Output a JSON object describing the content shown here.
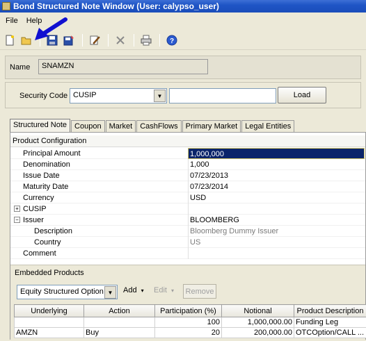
{
  "window": {
    "title": "Bond Structured Note Window (User: calypso_user)"
  },
  "menu": [
    {
      "label": "File"
    },
    {
      "label": "Help"
    }
  ],
  "toolbar": {
    "icons": [
      "new-icon",
      "open-icon",
      "save-icon",
      "save-as-icon",
      "edit-icon",
      "delete-icon",
      "print-icon",
      "help-icon"
    ],
    "annotation_arrow_color": "#1010d0"
  },
  "name_field": {
    "label": "Name",
    "value": "SNAMZN"
  },
  "security": {
    "label": "Security Code",
    "code_type": "CUSIP",
    "code_value": "",
    "load_label": "Load"
  },
  "tabs": [
    {
      "label": "Structured Note",
      "active": true
    },
    {
      "label": "Coupon"
    },
    {
      "label": "Market"
    },
    {
      "label": "CashFlows"
    },
    {
      "label": "Primary Market"
    },
    {
      "label": "Legal Entities"
    }
  ],
  "product_configuration": {
    "header": "Product Configuration",
    "rows": [
      {
        "label": "Principal Amount",
        "value": "1,000,000"
      },
      {
        "label": "Denomination",
        "value": "1,000"
      },
      {
        "label": "Issue Date",
        "value": "07/23/2013"
      },
      {
        "label": "Maturity Date",
        "value": "07/23/2014"
      },
      {
        "label": "Currency",
        "value": "USD"
      },
      {
        "label": "CUSIP",
        "value": ""
      },
      {
        "label": "Issuer",
        "value": "BLOOMBERG"
      },
      {
        "label": "Description",
        "value": "Bloomberg Dummy Issuer"
      },
      {
        "label": "Country",
        "value": "US"
      },
      {
        "label": "Comment",
        "value": ""
      }
    ],
    "expanders": {
      "cusip": "+",
      "issuer": "−"
    }
  },
  "embedded_products": {
    "header": "Embedded Products",
    "type_selected": "Equity Structured Option",
    "add_label": "Add",
    "edit_label": "Edit",
    "remove_label": "Remove",
    "columns": [
      "Underlying",
      "Action",
      "Participation (%)",
      "Notional",
      "Product Description"
    ],
    "rows": [
      [
        "",
        "",
        "100",
        "1,000,000.00",
        "Funding Leg"
      ],
      [
        "AMZN",
        "Buy",
        "20",
        "200,000.00",
        "OTCOption/CALL ..."
      ]
    ]
  },
  "colors": {
    "title_bar": "#1f55c5",
    "selection": "#0a246a",
    "window_bg": "#ece9d8"
  }
}
